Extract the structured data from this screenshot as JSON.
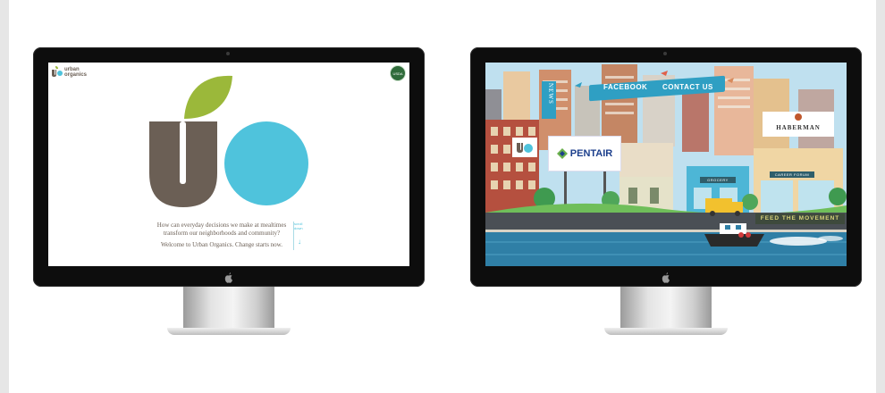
{
  "left_screen": {
    "logo_text_line1": "urban",
    "logo_text_line2": "organics",
    "seal_text": "USDA",
    "tagline_question": "How can everyday decisions we make at mealtimes transform our neighborhoods and community?",
    "tagline_welcome": "Welcome to Urban Organics. Change starts now.",
    "scroll_text": "scroll down",
    "colors": {
      "brown": "#6b5f55",
      "green": "#9bb83a",
      "blue": "#4fc3dc"
    }
  },
  "right_screen": {
    "nav": {
      "facebook": "FACEBOOK",
      "contact": "CONTACT US"
    },
    "news_sign": "NEWS",
    "pentair_label": "PENTAIR",
    "haberman_label": "HABERMAN",
    "grocery_sign": "GROCERY",
    "shop_sign": "CAREER FORUM",
    "feed_banner": "FEED THE MOVEMENT",
    "colors": {
      "sky": "#bfe0ef",
      "accent": "#2f9fc3",
      "road": "#4a4f55",
      "water": "#2f7fa6"
    }
  },
  "icons": [
    "apple-logo-icon",
    "bird-icon",
    "scroll-arrow-icon",
    "pentair-logo-icon"
  ]
}
